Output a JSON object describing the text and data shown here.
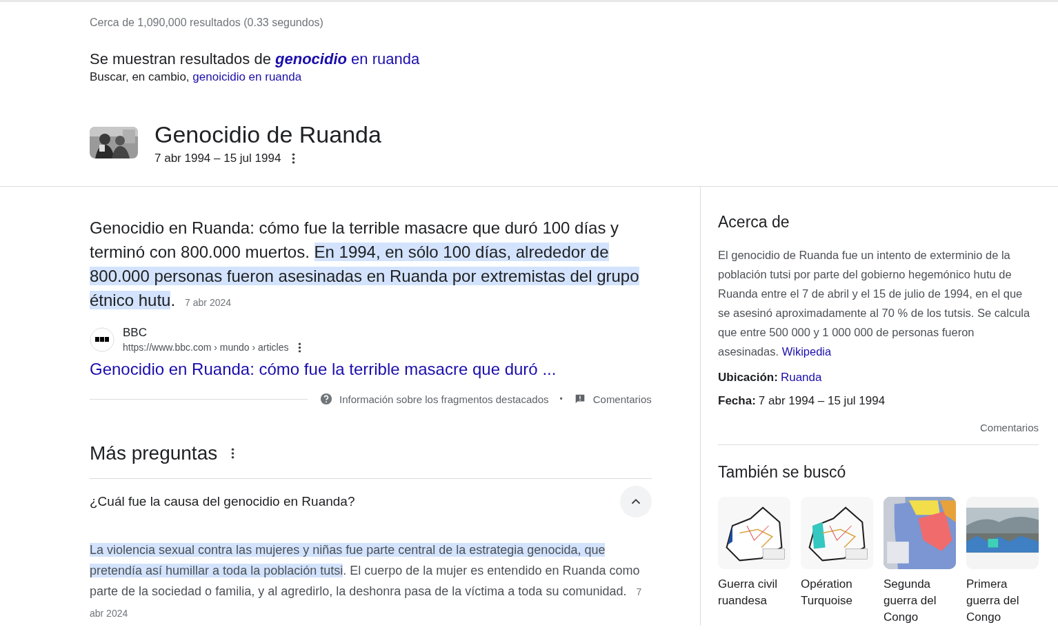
{
  "result_stats": "Cerca de 1,090,000 resultados (0.33 segundos)",
  "spelling": {
    "showing_prefix": "Se muestran resultados de ",
    "showing_link": "**genocidio** en ruanda",
    "instead_prefix": "Buscar, en cambio, ",
    "instead_link": "genoicidio en ruanda"
  },
  "entity": {
    "title": "Genocidio de Ruanda",
    "dates": "7 abr 1994 – 15 jul 1994"
  },
  "featured_snippet": {
    "segments": [
      {
        "text": "Genocidio en Ruanda: cómo fue la terrible masacre que duró 100 días y terminó con 800.000 muertos. ",
        "highlighted": false
      },
      {
        "text": "En 1994, en sólo 100 días, alrededor de 800.000 personas fueron asesinadas en Ruanda por extremistas del grupo étnico hutu",
        "highlighted": true
      },
      {
        "text": ".",
        "highlighted": false
      }
    ],
    "date": "7 abr 2024",
    "source": "BBC",
    "url": "https://www.bbc.com › mundo › articles",
    "link": "Genocidio en Ruanda: cómo fue la terrible masacre que duró ...",
    "about_link": "Información sobre los fragmentos destacados",
    "separator": "•",
    "feedback": "Comentarios"
  },
  "more_questions": {
    "title": "Más preguntas",
    "items": [
      {
        "question": "¿Cuál fue la causa del genocidio en Ruanda?",
        "expanded": true,
        "answer_segments": [
          {
            "text": "La violencia sexual contra las mujeres y niñas fue parte central de la estrategia genocida, que pretendía así humillar a toda la población tutsi",
            "highlighted": true
          },
          {
            "text": ". El cuerpo de la mujer es entendido en Ruanda como parte de la sociedad o familia, y al agredirlo, la deshonra pasa de la víctima a toda su comunidad.",
            "highlighted": false
          }
        ],
        "answer_date": "7 abr 2024"
      }
    ]
  },
  "about_panel": {
    "title": "Acerca de",
    "description": "El genocidio de Ruanda fue un intento de exterminio de la población tutsi por parte del gobierno hegemónico hutu de Ruanda entre el 7 de abril y el 15 de julio de 1994, en el que se asesinó aproximadamente al 70 % de los tutsis. Se calcula que entre 500 000 y 1 000 000 de personas fueron asesinadas. ",
    "source_link": "Wikipedia",
    "facts": [
      {
        "label": "Ubicación:",
        "value": "Ruanda",
        "kind": "link"
      },
      {
        "label": "Fecha:",
        "value": "7 abr 1994 – 15 jul 1994",
        "kind": "text"
      }
    ],
    "feedback": "Comentarios"
  },
  "also_searched": {
    "title": "También se buscó",
    "items": [
      {
        "label": "Guerra civil ruandesa",
        "kind": "map"
      },
      {
        "label": "Opération Turquoise",
        "kind": "map"
      },
      {
        "label": "Segunda guerra del Congo",
        "kind": "colormap"
      },
      {
        "label": "Primera guerra del Congo"
      }
    ]
  }
}
